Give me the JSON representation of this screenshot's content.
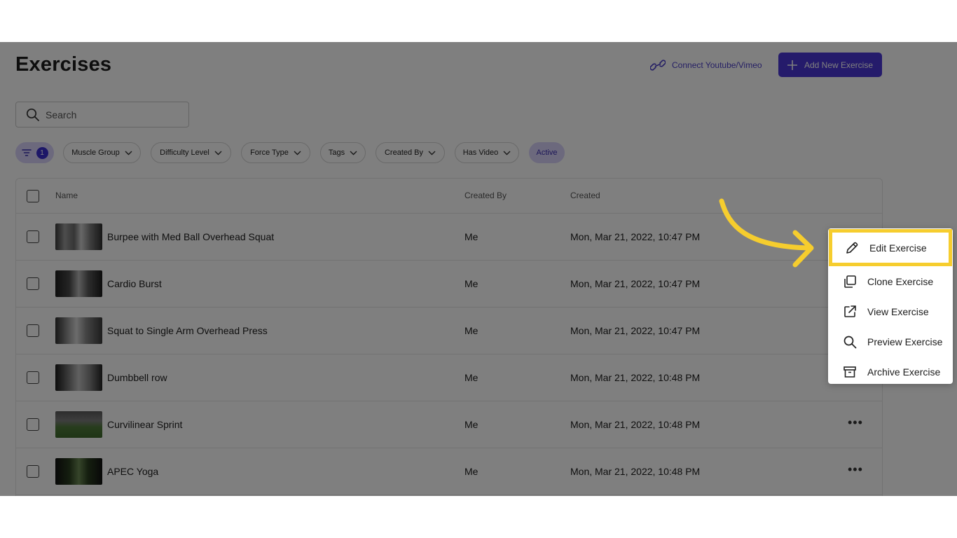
{
  "page": {
    "title": "Exercises",
    "connect_label": "Connect Youtube/Vimeo",
    "add_label": "Add New Exercise"
  },
  "search": {
    "placeholder": "Search",
    "value": ""
  },
  "filters": {
    "active_count": "1",
    "items": [
      {
        "label": "Muscle Group"
      },
      {
        "label": "Difficulty Level"
      },
      {
        "label": "Force Type"
      },
      {
        "label": "Tags"
      },
      {
        "label": "Created By"
      },
      {
        "label": "Has Video"
      }
    ],
    "status_label": "Active"
  },
  "table": {
    "headers": {
      "name": "Name",
      "created_by": "Created By",
      "created": "Created"
    },
    "rows": [
      {
        "name": "Burpee with Med Ball Overhead Squat",
        "created_by": "Me",
        "created": "Mon, Mar 21, 2022, 10:47 PM"
      },
      {
        "name": "Cardio Burst",
        "created_by": "Me",
        "created": "Mon, Mar 21, 2022, 10:47 PM"
      },
      {
        "name": "Squat to Single Arm Overhead Press",
        "created_by": "Me",
        "created": "Mon, Mar 21, 2022, 10:47 PM"
      },
      {
        "name": "Dumbbell row",
        "created_by": "Me",
        "created": "Mon, Mar 21, 2022, 10:48 PM"
      },
      {
        "name": "Curvilinear Sprint",
        "created_by": "Me",
        "created": "Mon, Mar 21, 2022, 10:48 PM"
      },
      {
        "name": "APEC Yoga",
        "created_by": "Me",
        "created": "Mon, Mar 21, 2022, 10:48 PM"
      }
    ],
    "more_label": "•••"
  },
  "context_menu": {
    "items": [
      {
        "label": "Edit Exercise",
        "icon": "pencil-icon"
      },
      {
        "label": "Clone Exercise",
        "icon": "copy-icon"
      },
      {
        "label": "View Exercise",
        "icon": "external-link-icon"
      },
      {
        "label": "Preview Exercise",
        "icon": "search-icon"
      },
      {
        "label": "Archive Exercise",
        "icon": "archive-icon"
      }
    ]
  },
  "colors": {
    "accent": "#4a36d6",
    "highlight": "#f6cd2e",
    "pill_active": "#d9d2fb"
  }
}
